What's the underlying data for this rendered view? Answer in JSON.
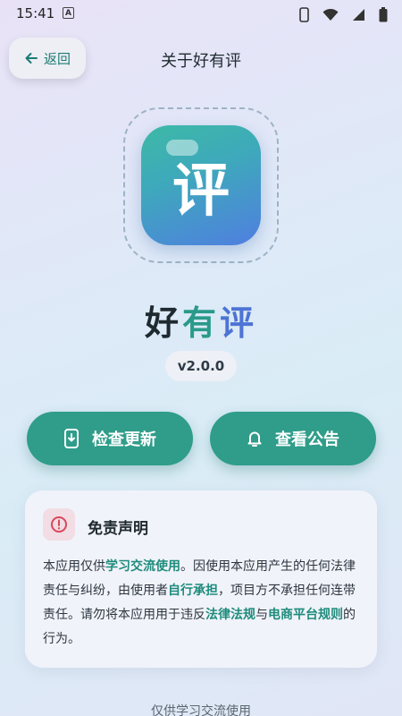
{
  "status_bar": {
    "time": "15:41",
    "badge": "A"
  },
  "header": {
    "back_label": "返回",
    "title": "关于好有评"
  },
  "logo": {
    "char": "评"
  },
  "app": {
    "name_parts": [
      "好",
      "有",
      "评"
    ],
    "version": "v2.0.0"
  },
  "actions": {
    "check_update": "检查更新",
    "view_notice": "查看公告"
  },
  "disclaimer": {
    "title": "免责声明",
    "segments": [
      "本应用仅供",
      "学习交流使用",
      "。因使用本应用产生的任何法律责任与纠纷，由使用者",
      "自行承担",
      "，项目方不承担任何连带责任。请勿将本应用用于违反",
      "法律法规",
      "与",
      "电商平台规则",
      "的行为。"
    ]
  },
  "footer": {
    "text": "仅供学习交流使用"
  },
  "colors": {
    "accent": "#2f9d8a",
    "accent_text": "#1e8c7c",
    "blue": "#4d74d4"
  }
}
